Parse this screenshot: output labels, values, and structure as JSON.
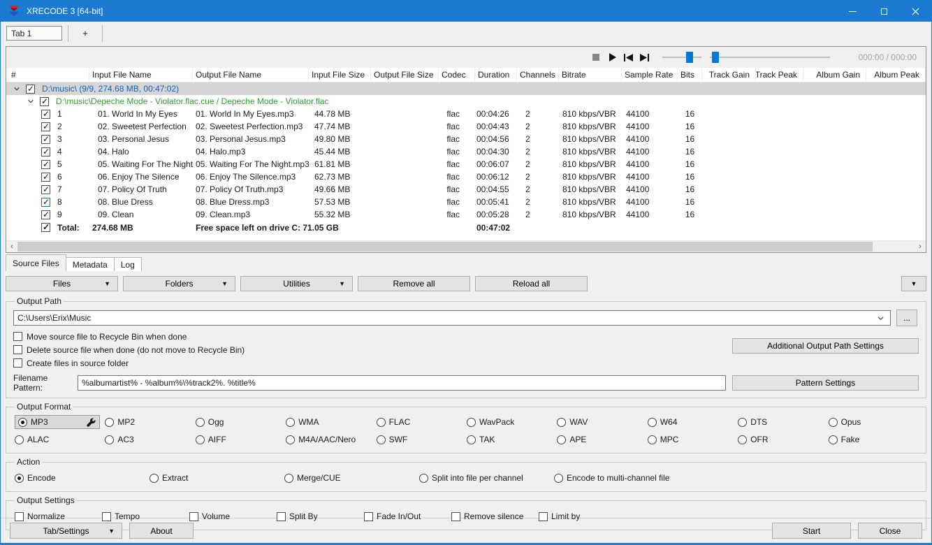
{
  "colors": {
    "titlebar": "#1d7ad2",
    "accent": "#0078d7",
    "group_text": "#1560b8",
    "album_text": "#2f9e2f"
  },
  "window": {
    "title": "XRECODE 3 [64-bit]",
    "controls": [
      "minimize",
      "maximize",
      "close"
    ]
  },
  "tab_strip": {
    "tab_label": "Tab 1",
    "add_tab_label": "+"
  },
  "player": {
    "icons": [
      "stop-icon",
      "play-icon",
      "previous-track-icon",
      "next-track-icon"
    ],
    "volume_percent": 70,
    "position_percent": 3,
    "time_display": "000:00 / 000:00"
  },
  "table": {
    "columns": [
      "#",
      "Input File Name",
      "Output File Name",
      "Input File Size",
      "Output File Size",
      "Codec",
      "Duration",
      "Channels",
      "Bitrate",
      "Sample Rate",
      "Bits",
      "Track Gain",
      "Track Peak",
      "Album Gain",
      "Album Peak"
    ],
    "group_row": {
      "label": "D:\\music\\ (9/9, 274.68 MB, 00:47:02)",
      "checked": true,
      "expanded": true
    },
    "album_row": {
      "label": "D:\\music\\Depeche Mode - Violator.flac.cue / Depeche Mode - Violator.flac",
      "checked": true,
      "expanded": true
    },
    "rows": [
      {
        "num": "1",
        "input": "01. World In My Eyes",
        "output": "01. World In My Eyes.mp3",
        "input_size": "44.78 MB",
        "codec": "flac",
        "duration": "00:04:26",
        "channels": "2",
        "bitrate": "810 kbps/VBR",
        "sample_rate": "44100",
        "bits": "16",
        "checked": true
      },
      {
        "num": "2",
        "input": "02. Sweetest Perfection",
        "output": "02. Sweetest Perfection.mp3",
        "input_size": "47.74 MB",
        "codec": "flac",
        "duration": "00:04:43",
        "channels": "2",
        "bitrate": "810 kbps/VBR",
        "sample_rate": "44100",
        "bits": "16",
        "checked": true
      },
      {
        "num": "3",
        "input": "03. Personal Jesus",
        "output": "03. Personal Jesus.mp3",
        "input_size": "49.80 MB",
        "codec": "flac",
        "duration": "00:04:56",
        "channels": "2",
        "bitrate": "810 kbps/VBR",
        "sample_rate": "44100",
        "bits": "16",
        "checked": true
      },
      {
        "num": "4",
        "input": "04. Halo",
        "output": "04. Halo.mp3",
        "input_size": "45.44 MB",
        "codec": "flac",
        "duration": "00:04:30",
        "channels": "2",
        "bitrate": "810 kbps/VBR",
        "sample_rate": "44100",
        "bits": "16",
        "checked": true
      },
      {
        "num": "5",
        "input": "05. Waiting For The Night",
        "output": "05. Waiting For The Night.mp3",
        "input_size": "61.81 MB",
        "codec": "flac",
        "duration": "00:06:07",
        "channels": "2",
        "bitrate": "810 kbps/VBR",
        "sample_rate": "44100",
        "bits": "16",
        "checked": true
      },
      {
        "num": "6",
        "input": "06. Enjoy The Silence",
        "output": "06. Enjoy The Silence.mp3",
        "input_size": "62.73 MB",
        "codec": "flac",
        "duration": "00:06:12",
        "channels": "2",
        "bitrate": "810 kbps/VBR",
        "sample_rate": "44100",
        "bits": "16",
        "checked": true
      },
      {
        "num": "7",
        "input": "07. Policy Of Truth",
        "output": "07. Policy Of Truth.mp3",
        "input_size": "49.66 MB",
        "codec": "flac",
        "duration": "00:04:55",
        "channels": "2",
        "bitrate": "810 kbps/VBR",
        "sample_rate": "44100",
        "bits": "16",
        "checked": true
      },
      {
        "num": "8",
        "input": "08. Blue Dress",
        "output": "08. Blue Dress.mp3",
        "input_size": "57.53 MB",
        "codec": "flac",
        "duration": "00:05:41",
        "channels": "2",
        "bitrate": "810 kbps/VBR",
        "sample_rate": "44100",
        "bits": "16",
        "checked": true,
        "focused": true
      },
      {
        "num": "9",
        "input": "09. Clean",
        "output": "09. Clean.mp3",
        "input_size": "55.32 MB",
        "codec": "flac",
        "duration": "00:05:28",
        "channels": "2",
        "bitrate": "810 kbps/VBR",
        "sample_rate": "44100",
        "bits": "16",
        "checked": true
      }
    ],
    "total_row": {
      "label": "Total:",
      "input_size": "274.68 MB",
      "free_space": "Free space left on drive C: 71.05 GB",
      "duration": "00:47:02",
      "checked": true
    }
  },
  "panel_tabs": [
    {
      "label": "Source Files",
      "selected": true
    },
    {
      "label": "Metadata",
      "selected": false
    },
    {
      "label": "Log",
      "selected": false
    }
  ],
  "toolbar": {
    "files": "Files",
    "folders": "Folders",
    "utilities": "Utilities",
    "remove_all": "Remove all",
    "reload_all": "Reload all"
  },
  "output_path": {
    "legend": "Output Path",
    "path": "C:\\Users\\Erix\\Music",
    "browse_label": "...",
    "options": [
      "Move source file to Recycle Bin when done",
      "Delete source file when done (do not move to Recycle Bin)",
      "Create files in source folder"
    ],
    "options_checked": [
      false,
      false,
      false
    ],
    "additional_btn": "Additional Output Path Settings",
    "pattern_label": "Filename Pattern:",
    "pattern_value": "%albumartist% - %album%\\%track2%. %title%",
    "pattern_btn": "Pattern Settings"
  },
  "output_format": {
    "legend": "Output Format",
    "selected": "MP3",
    "row1": [
      "MP3",
      "MP2",
      "Ogg",
      "WMA",
      "FLAC",
      "WavPack",
      "WAV",
      "W64",
      "DTS",
      "Opus"
    ],
    "row2": [
      "ALAC",
      "AC3",
      "AIFF",
      "M4A/AAC/Nero",
      "SWF",
      "TAK",
      "APE",
      "MPC",
      "OFR",
      "Fake"
    ]
  },
  "action": {
    "legend": "Action",
    "selected": "Encode",
    "options": [
      "Encode",
      "Extract",
      "Merge/CUE",
      "Split into file per channel",
      "Encode to multi-channel file"
    ]
  },
  "output_settings": {
    "legend": "Output Settings",
    "options": [
      "Normalize",
      "Tempo",
      "Volume",
      "Split By",
      "Fade In/Out",
      "Remove silence",
      "Limit by"
    ]
  },
  "bottom_bar": {
    "tab_settings": "Tab/Settings",
    "about": "About",
    "start": "Start",
    "close": "Close"
  }
}
